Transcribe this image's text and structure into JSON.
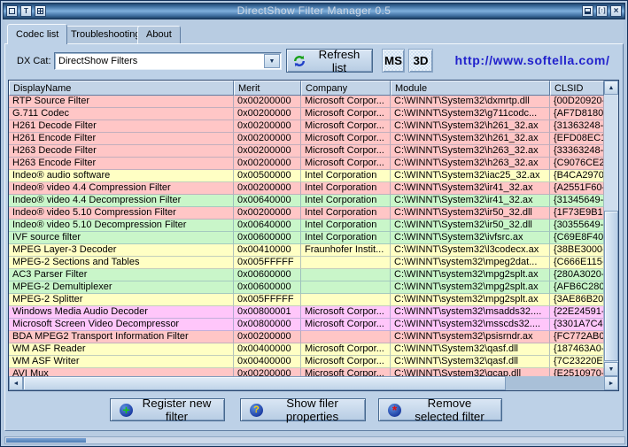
{
  "window": {
    "title": "DirectShow Filter Manager 0.5",
    "restore_glyph": "[↑]",
    "tray_glyph": "T",
    "close_glyph": "×"
  },
  "tabs": [
    {
      "label": "Codec list",
      "active": true
    },
    {
      "label": "Troubleshooting",
      "active": false
    },
    {
      "label": "About",
      "active": false
    }
  ],
  "toolbar": {
    "dx_cat_label": "DX Cat:",
    "dx_cat_value": "DirectShow Filters",
    "refresh_label": "Refresh list",
    "ms_label": "MS",
    "threed_label": "3D",
    "url": "http://www.softella.com/"
  },
  "icons": {
    "combo_arrow": "▼",
    "scroll_up": "▲",
    "scroll_down": "▼",
    "scroll_left": "◄",
    "scroll_right": "►"
  },
  "table": {
    "columns": [
      "DisplayName",
      "Merit",
      "Company",
      "Module",
      "CLSID"
    ],
    "rows": [
      {
        "name": "RTP Source Filter",
        "merit": "0x00200000",
        "company": "Microsoft Corpor...",
        "module": "C:\\WINNT\\System32\\dxmrtp.dll",
        "clsid": "{00D20920-",
        "color": "pink"
      },
      {
        "name": "G.711 Codec",
        "merit": "0x00200000",
        "company": "Microsoft Corpor...",
        "module": "C:\\WINNT\\System32\\g711codc...",
        "clsid": "{AF7D8180-",
        "color": "pink"
      },
      {
        "name": "H261 Decode Filter",
        "merit": "0x00200000",
        "company": "Microsoft Corpor...",
        "module": "C:\\WINNT\\System32\\h261_32.ax",
        "clsid": "{31363248-",
        "color": "pink"
      },
      {
        "name": "H261 Encode Filter",
        "merit": "0x00200000",
        "company": "Microsoft Corpor...",
        "module": "C:\\WINNT\\System32\\h261_32.ax",
        "clsid": "{EFD08EC1",
        "color": "pink"
      },
      {
        "name": "H263 Decode Filter",
        "merit": "0x00200000",
        "company": "Microsoft Corpor...",
        "module": "C:\\WINNT\\System32\\h263_32.ax",
        "clsid": "{33363248-",
        "color": "pink"
      },
      {
        "name": "H263 Encode Filter",
        "merit": "0x00200000",
        "company": "Microsoft Corpor...",
        "module": "C:\\WINNT\\System32\\h263_32.ax",
        "clsid": "{C9076CE2-",
        "color": "pink"
      },
      {
        "name": "Indeo® audio software",
        "merit": "0x00500000",
        "company": "Intel Corporation",
        "module": "C:\\WINNT\\System32\\iac25_32.ax",
        "clsid": "{B4CA2970-",
        "color": "yellow"
      },
      {
        "name": "Indeo® video 4.4 Compression Filter",
        "merit": "0x00200000",
        "company": "Intel Corporation",
        "module": "C:\\WINNT\\System32\\ir41_32.ax",
        "clsid": "{A2551F60-",
        "color": "pink"
      },
      {
        "name": "Indeo® video 4.4 Decompression Filter",
        "merit": "0x00640000",
        "company": "Intel Corporation",
        "module": "C:\\WINNT\\System32\\ir41_32.ax",
        "clsid": "{31345649-",
        "color": "green"
      },
      {
        "name": "Indeo® video 5.10 Compression Filter",
        "merit": "0x00200000",
        "company": "Intel Corporation",
        "module": "C:\\WINNT\\System32\\ir50_32.dll",
        "clsid": "{1F73E9B1-",
        "color": "pink"
      },
      {
        "name": "Indeo® video 5.10 Decompression Filter",
        "merit": "0x00640000",
        "company": "Intel Corporation",
        "module": "C:\\WINNT\\System32\\ir50_32.dll",
        "clsid": "{30355649-",
        "color": "green"
      },
      {
        "name": "IVF source filter",
        "merit": "0x00600000",
        "company": "Intel Corporation",
        "module": "C:\\WINNT\\System32\\ivfsrc.ax",
        "clsid": "{C69E8F40-",
        "color": "green"
      },
      {
        "name": "MPEG Layer-3 Decoder",
        "merit": "0x00410000",
        "company": "Fraunhofer Instit...",
        "module": "C:\\WINNT\\System32\\l3codecx.ax",
        "clsid": "{38BE3000-",
        "color": "yellow"
      },
      {
        "name": "MPEG-2 Sections and Tables",
        "merit": "0x005FFFFF",
        "company": "",
        "module": "C:\\WINNT\\system32\\mpeg2dat...",
        "clsid": "{C666E115-",
        "color": "yellow"
      },
      {
        "name": "AC3 Parser Filter",
        "merit": "0x00600000",
        "company": "",
        "module": "C:\\WINNT\\system32\\mpg2splt.ax",
        "clsid": "{280A3020-",
        "color": "green"
      },
      {
        "name": "MPEG-2 Demultiplexer",
        "merit": "0x00600000",
        "company": "",
        "module": "C:\\WINNT\\system32\\mpg2splt.ax",
        "clsid": "{AFB6C280-",
        "color": "green"
      },
      {
        "name": "MPEG-2 Splitter",
        "merit": "0x005FFFFF",
        "company": "",
        "module": "C:\\WINNT\\system32\\mpg2splt.ax",
        "clsid": "{3AE86B20-",
        "color": "yellow"
      },
      {
        "name": "Windows Media Audio Decoder",
        "merit": "0x00800001",
        "company": "Microsoft Corpor...",
        "module": "C:\\WINNT\\system32\\msadds32....",
        "clsid": "{22E24591-",
        "color": "magenta"
      },
      {
        "name": "Microsoft Screen Video Decompressor",
        "merit": "0x00800000",
        "company": "Microsoft Corpor...",
        "module": "C:\\WINNT\\system32\\msscds32....",
        "clsid": "{3301A7C4-",
        "color": "magenta"
      },
      {
        "name": "BDA MPEG2 Transport Information Filter",
        "merit": "0x00200000",
        "company": "",
        "module": "C:\\WINNT\\system32\\psisrndr.ax",
        "clsid": "{FC772AB0-",
        "color": "pink"
      },
      {
        "name": "WM ASF Reader",
        "merit": "0x00400000",
        "company": "Microsoft Corpor...",
        "module": "C:\\WINNT\\System32\\qasf.dll",
        "clsid": "{187463A0-",
        "color": "yellow"
      },
      {
        "name": "WM ASF Writer",
        "merit": "0x00400000",
        "company": "Microsoft Corpor...",
        "module": "C:\\WINNT\\System32\\qasf.dll",
        "clsid": "{7C23220E-",
        "color": "yellow"
      },
      {
        "name": "AVI Mux",
        "merit": "0x00200000",
        "company": "Microsoft Corpor...",
        "module": "C:\\WINNT\\System32\\qcap.dll",
        "clsid": "{E2510970-",
        "color": "pink"
      }
    ]
  },
  "footer": {
    "register_label": "Register new filter",
    "register_glyph": "+",
    "properties_label": "Show filer properties",
    "properties_glyph": "?",
    "remove_label": "Remove selected filter",
    "remove_glyph": "*"
  },
  "colors": {
    "pink": "#ffc6c6",
    "yellow": "#ffffc4",
    "green": "#c9f6c9",
    "magenta": "#ffc6fa",
    "url_blue": "#2121cc",
    "titlebar_mid": "#7fb0dd",
    "panel": "#bdd1e7"
  }
}
